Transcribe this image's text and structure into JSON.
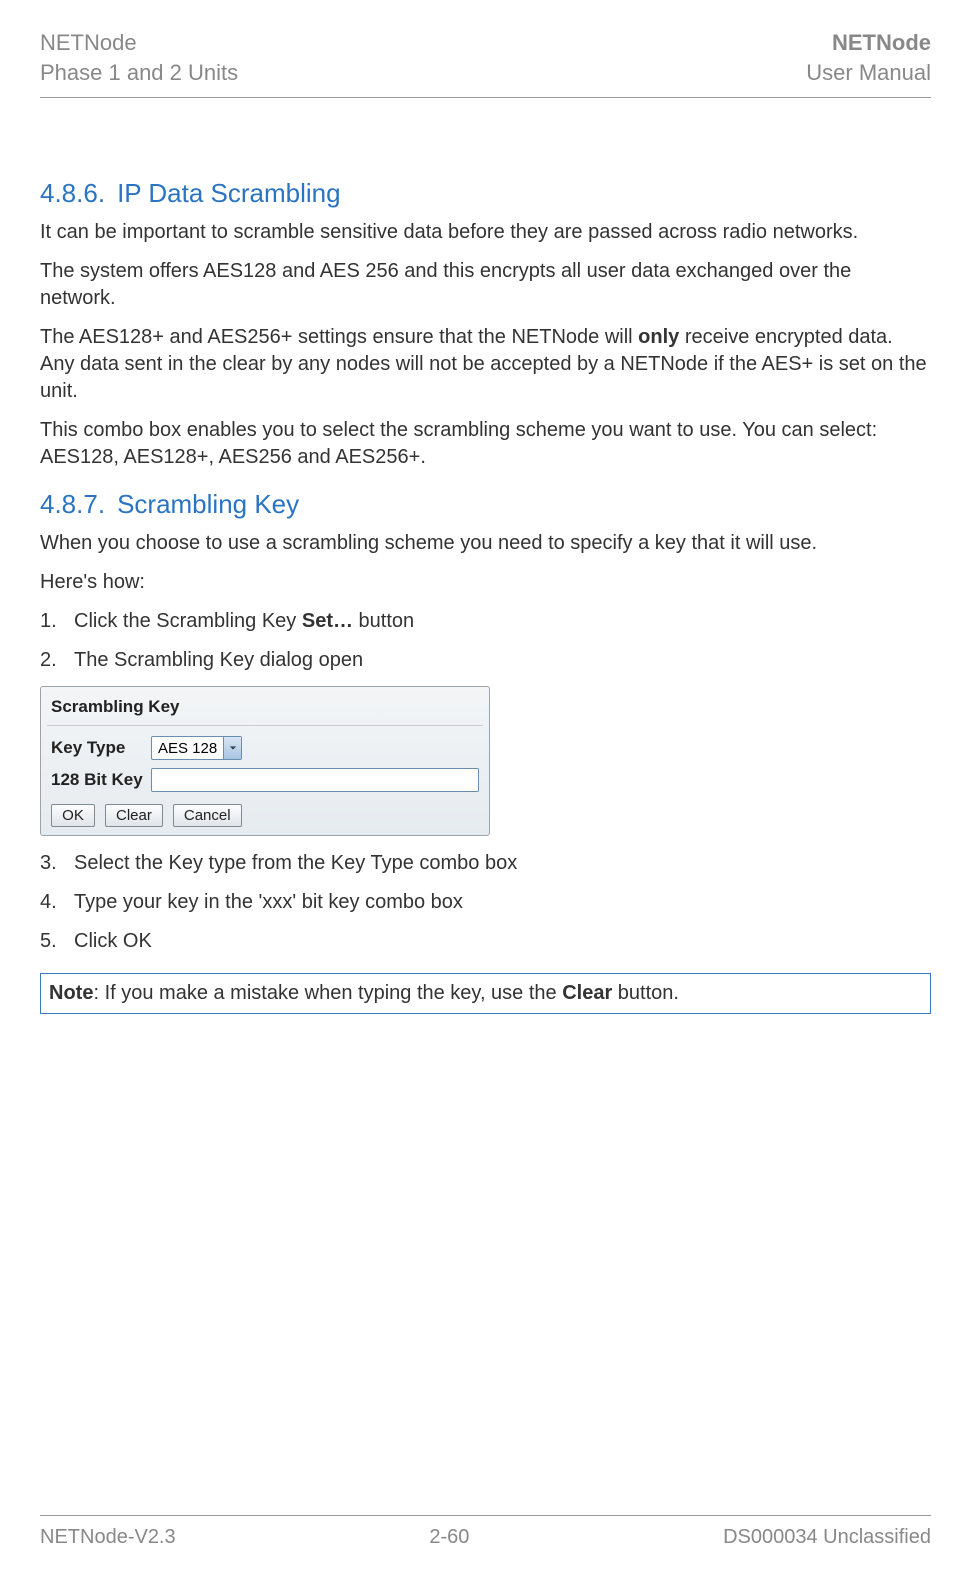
{
  "header": {
    "left_line1": "NETNode",
    "left_line2": "Phase 1 and 2 Units",
    "right_line1": "NETNode",
    "right_line2": "User Manual"
  },
  "sections": {
    "s1": {
      "num": "4.8.6.",
      "title": "IP Data Scrambling",
      "p1": "It can be important to scramble sensitive data before they are passed across radio networks.",
      "p2": "The system offers AES128 and AES 256 and this encrypts all user data exchanged over the network.",
      "p3a": "The AES128+ and AES256+ settings ensure that the NETNode will ",
      "p3b_bold": "only",
      "p3c": " receive encrypted data. Any data sent in the clear by any nodes will not be accepted by a NETNode if the AES+ is set on the unit.",
      "p4": "This combo box enables you to select the scrambling scheme you want to use. You can select: AES128, AES128+, AES256 and AES256+."
    },
    "s2": {
      "num": "4.8.7.",
      "title": "Scrambling Key",
      "p1": "When you choose to use a scrambling scheme you need to specify a key that it will use.",
      "p2": "Here's how:",
      "steps": {
        "n1": "1.",
        "t1a": "Click the Scrambling Key ",
        "t1b_bold": "Set…",
        "t1c": " button",
        "n2": "2.",
        "t2": "The Scrambling Key dialog open",
        "n3": "3.",
        "t3": "Select the Key type from the Key Type combo box",
        "n4": "4.",
        "t4": "Type your key in the 'xxx' bit key combo box",
        "n5": "5.",
        "t5": "Click OK"
      }
    }
  },
  "dialog": {
    "title": "Scrambling Key",
    "keytype_label": "Key Type",
    "keytype_value": "AES 128",
    "bitkey_label": "128 Bit Key",
    "bitkey_value": "",
    "buttons": {
      "ok": "OK",
      "clear": "Clear",
      "cancel": "Cancel"
    }
  },
  "note": {
    "label": "Note",
    "text_a": ": If you make a mistake when typing the key, use the ",
    "text_b_bold": "Clear",
    "text_c": " button."
  },
  "footer": {
    "left": "NETNode-V2.3",
    "center": "2-60",
    "right": "DS000034 Unclassified"
  }
}
